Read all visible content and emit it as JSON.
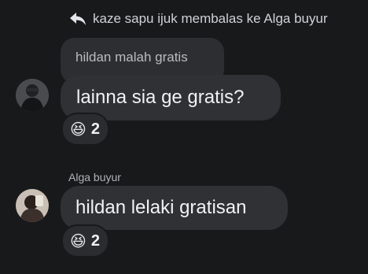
{
  "reply_header": {
    "text": "kaze sapu ijuk membalas ke Alga buyur",
    "icon": "reply-arrow-icon"
  },
  "quoted_message": {
    "text": "hildan malah gratis"
  },
  "messages": [
    {
      "text": "lainna sia ge gratis?",
      "reaction": {
        "emoji": "😆",
        "count": "2"
      }
    },
    {
      "sender": "Alga buyur",
      "text": "hildan lelaki gratisan",
      "reaction": {
        "emoji": "😆",
        "count": "2"
      }
    }
  ],
  "colors": {
    "background": "#18191a",
    "bubble": "#303134",
    "quoted_bubble": "#2c2e31"
  }
}
